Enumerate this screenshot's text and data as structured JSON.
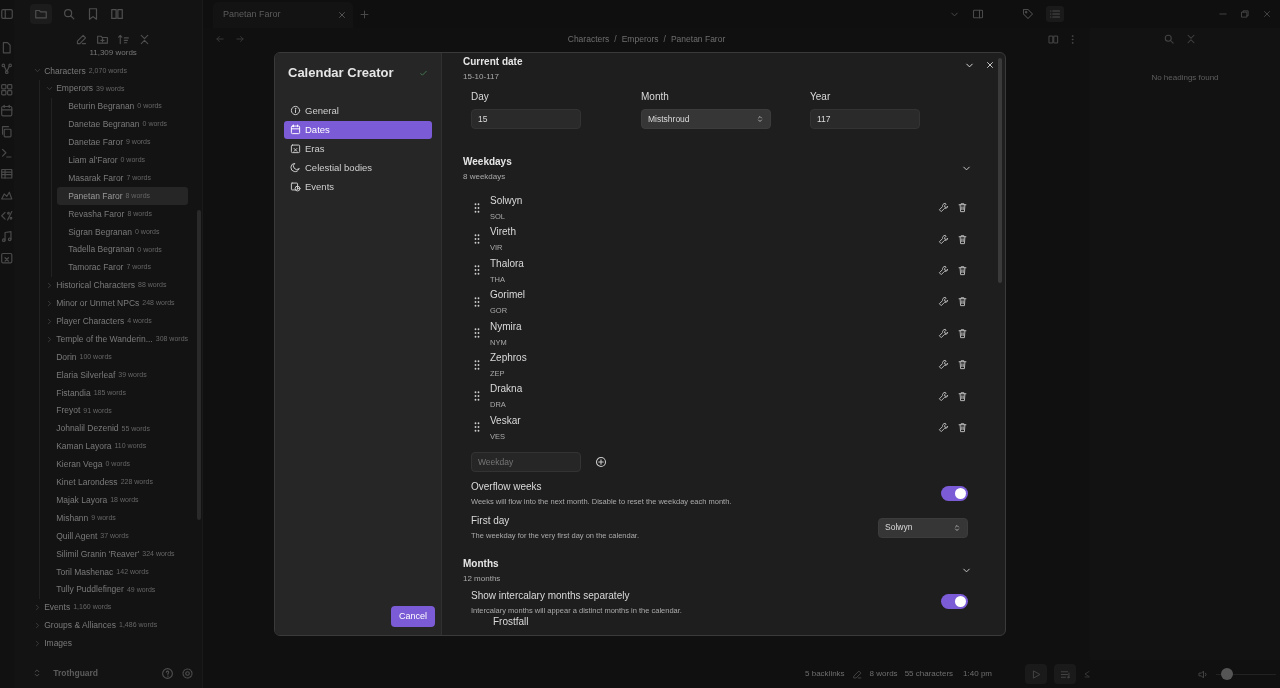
{
  "sidebar": {
    "word_count": "11,309 words",
    "tree": [
      {
        "kind": "folder",
        "label": "Characters",
        "count": "2,070 words",
        "expanded": true,
        "selected": false,
        "children": [
          {
            "kind": "folder",
            "label": "Emperors",
            "count": "39 words",
            "expanded": true,
            "selected": false,
            "children": [
              {
                "kind": "file",
                "label": "Beturin Begranan",
                "count": "0 words",
                "selected": false
              },
              {
                "kind": "file",
                "label": "Danetae Begranan",
                "count": "0 words",
                "selected": false
              },
              {
                "kind": "file",
                "label": "Danetae Faror",
                "count": "9 words",
                "selected": false
              },
              {
                "kind": "file",
                "label": "Liam al'Faror",
                "count": "0 words",
                "selected": false
              },
              {
                "kind": "file",
                "label": "Masarak Faror",
                "count": "7 words",
                "selected": false
              },
              {
                "kind": "file",
                "label": "Panetan Faror",
                "count": "8 words",
                "selected": true
              },
              {
                "kind": "file",
                "label": "Revasha Faror",
                "count": "8 words",
                "selected": false
              },
              {
                "kind": "file",
                "label": "Sigran Begranan",
                "count": "0 words",
                "selected": false
              },
              {
                "kind": "file",
                "label": "Tadella Begranan",
                "count": "0 words",
                "selected": false
              },
              {
                "kind": "file",
                "label": "Tamorac Faror",
                "count": "7 words",
                "selected": false
              }
            ]
          },
          {
            "kind": "folder",
            "label": "Historical Characters",
            "count": "88 words",
            "expanded": false,
            "selected": false
          },
          {
            "kind": "folder",
            "label": "Minor or Unmet NPCs",
            "count": "248 words",
            "expanded": false,
            "selected": false
          },
          {
            "kind": "folder",
            "label": "Player Characters",
            "count": "4 words",
            "expanded": false,
            "selected": false
          },
          {
            "kind": "folder",
            "label": "Temple of the Wanderin...",
            "count": "308 words",
            "expanded": false,
            "selected": false
          },
          {
            "kind": "file",
            "label": "Dorin",
            "count": "100 words",
            "selected": false
          },
          {
            "kind": "file",
            "label": "Elaria Silverleaf",
            "count": "39 words",
            "selected": false
          },
          {
            "kind": "file",
            "label": "Fistandia",
            "count": "185 words",
            "selected": false
          },
          {
            "kind": "file",
            "label": "Freyot",
            "count": "91 words",
            "selected": false
          },
          {
            "kind": "file",
            "label": "Johnalil Dezenid",
            "count": "55 words",
            "selected": false
          },
          {
            "kind": "file",
            "label": "Kaman Layora",
            "count": "110 words",
            "selected": false
          },
          {
            "kind": "file",
            "label": "Kieran Vega",
            "count": "0 words",
            "selected": false
          },
          {
            "kind": "file",
            "label": "Kinet Larondess",
            "count": "228 words",
            "selected": false
          },
          {
            "kind": "file",
            "label": "Majak Layora",
            "count": "18 words",
            "selected": false
          },
          {
            "kind": "file",
            "label": "Mishann",
            "count": "9 words",
            "selected": false
          },
          {
            "kind": "file",
            "label": "Quill Agent",
            "count": "37 words",
            "selected": false
          },
          {
            "kind": "file",
            "label": "Silimil Granin 'Reaver'",
            "count": "324 words",
            "selected": false
          },
          {
            "kind": "file",
            "label": "Toril Mashenac",
            "count": "142 words",
            "selected": false
          },
          {
            "kind": "file",
            "label": "Tully Puddlefinger",
            "count": "49 words",
            "selected": false
          }
        ]
      },
      {
        "kind": "folder",
        "label": "Events",
        "count": "1,160 words",
        "expanded": false,
        "selected": false
      },
      {
        "kind": "folder",
        "label": "Groups & Alliances",
        "count": "1,486 words",
        "expanded": false,
        "selected": false
      },
      {
        "kind": "folder",
        "label": "Images",
        "expanded": false,
        "selected": false
      }
    ],
    "vault": "Trothguard"
  },
  "tab": {
    "title": "Panetan Faror"
  },
  "breadcrumb": {
    "items": [
      "Characters",
      "Emperors",
      "Panetan Faror"
    ],
    "separators": [
      "/",
      "/"
    ]
  },
  "outline": {
    "empty_text": "No headings found"
  },
  "status_bar": {
    "backlinks": "5 backlinks",
    "words": "8 words",
    "characters": "55 characters",
    "time": "1:40 pm",
    "volume": {
      "level": 0.1
    }
  },
  "modal": {
    "title": "Calendar Creator",
    "nav": [
      {
        "label": "General",
        "selected": false
      },
      {
        "label": "Dates",
        "selected": true
      },
      {
        "label": "Eras",
        "selected": false
      },
      {
        "label": "Celestial bodies",
        "selected": false
      },
      {
        "label": "Events",
        "selected": false
      }
    ],
    "cancel": "Cancel",
    "current_date": {
      "title": "Current date",
      "value": "15-10-117",
      "fields": [
        {
          "kind": "input",
          "label": "Day",
          "value": "15"
        },
        {
          "kind": "select",
          "label": "Month",
          "value": "Mistshroud"
        },
        {
          "kind": "input",
          "label": "Year",
          "value": "117"
        }
      ]
    },
    "weekdays": {
      "title": "Weekdays",
      "count": "8 weekdays",
      "items": [
        {
          "name": "Solwyn",
          "abbr": "SOL"
        },
        {
          "name": "Vireth",
          "abbr": "VIR"
        },
        {
          "name": "Thalora",
          "abbr": "THA"
        },
        {
          "name": "Gorimel",
          "abbr": "GOR"
        },
        {
          "name": "Nymira",
          "abbr": "NYM"
        },
        {
          "name": "Zephros",
          "abbr": "ZEP"
        },
        {
          "name": "Drakna",
          "abbr": "DRA"
        },
        {
          "name": "Veskar",
          "abbr": "VES"
        }
      ],
      "placeholder": "Weekday",
      "settings": [
        {
          "kind": "toggle",
          "label": "Overflow weeks",
          "description": "Weeks will flow into the next month. Disable to reset the weekday each month.",
          "on": true
        },
        {
          "kind": "select",
          "label": "First day",
          "description": "The weekday for the very first day on the calendar.",
          "value": "Solwyn"
        }
      ]
    },
    "months": {
      "title": "Months",
      "count": "12 months",
      "settings": [
        {
          "kind": "toggle",
          "label": "Show intercalary months separately",
          "description": "Intercalary months will appear a distinct months in the calendar.",
          "on": true
        }
      ],
      "items": [
        {
          "name": "Frostfall"
        }
      ]
    }
  }
}
